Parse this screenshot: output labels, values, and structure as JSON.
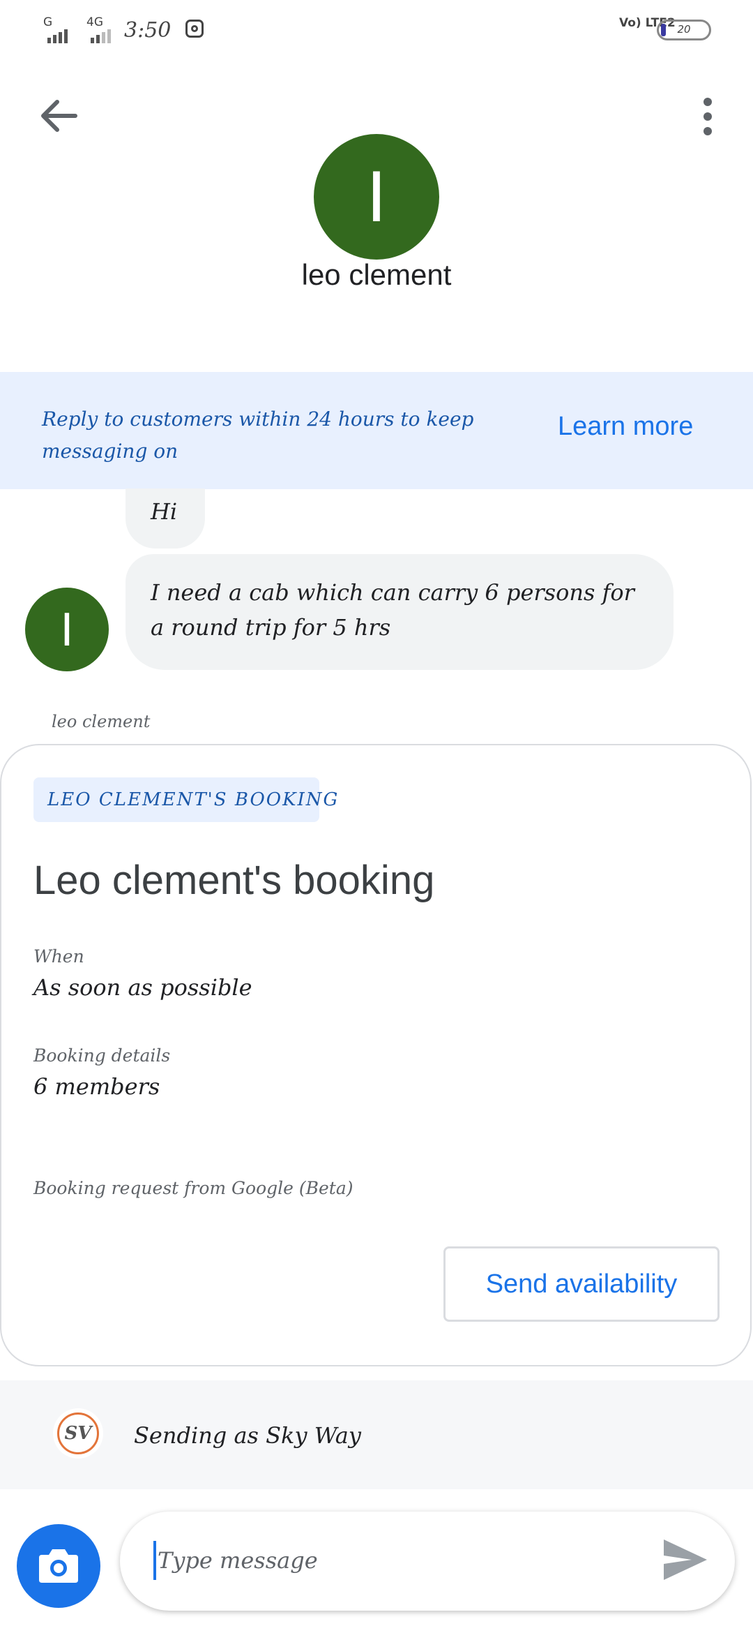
{
  "status_bar": {
    "network1": "G",
    "network2": "4G",
    "time": "3:50",
    "volte": "Vo) LTE2",
    "battery": "20",
    "battery_level": 0.2
  },
  "header": {
    "avatar_initial": "I",
    "contact_name": "leo clement",
    "back_icon": "arrow-left-icon",
    "menu_icon": "more-vert-icon"
  },
  "banner": {
    "text": "Reply to customers within 24 hours to keep messaging on",
    "link": "Learn more"
  },
  "messages": [
    {
      "text": "Hi"
    },
    {
      "text": "I need a cab which can carry 6 persons for a round trip for 5 hrs"
    }
  ],
  "message_avatar_initial": "I",
  "sender_label": "leo clement",
  "card": {
    "chip": "LEO CLEMENT'S BOOKING",
    "title": "Leo clement's booking",
    "fields": [
      {
        "label": "When",
        "value": "As soon as possible"
      },
      {
        "label": "Booking details",
        "value": "6 members"
      }
    ],
    "note": "Booking request from Google (Beta)",
    "button": "Send availability"
  },
  "sending_as": {
    "logo_text": "SV",
    "text": "Sending as Sky Way"
  },
  "composer": {
    "placeholder": "Type message",
    "value": "",
    "camera_icon": "camera-icon",
    "send_icon": "send-icon"
  },
  "colors": {
    "avatar_green": "#33691e",
    "accent_blue": "#1a73e8",
    "banner_bg": "#e8f0fe"
  }
}
